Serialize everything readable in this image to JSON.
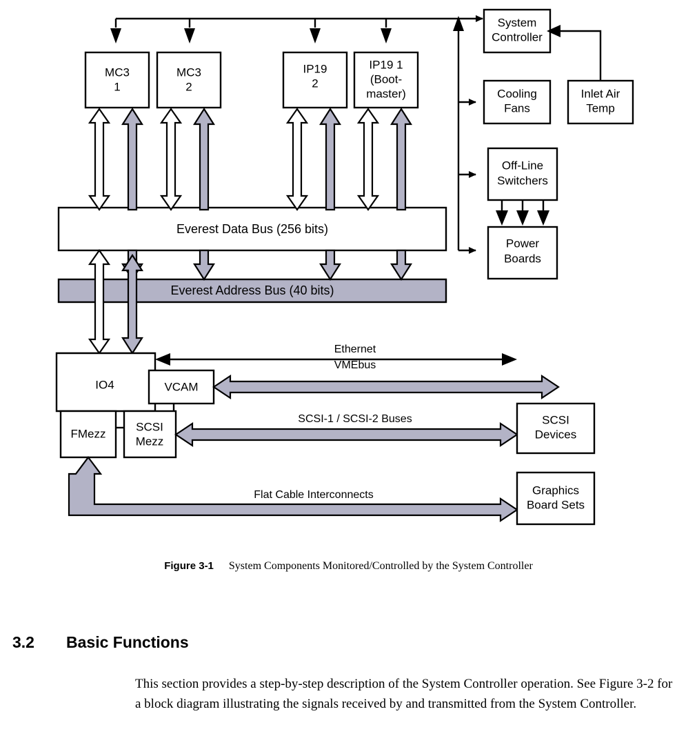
{
  "figure": {
    "number": "Figure 3-1",
    "caption": "System Components Monitored/Controlled by the System Controller"
  },
  "section": {
    "number": "3.2",
    "title": "Basic Functions",
    "body": "This section provides a step-by-step description of the System Controller operation. See Figure 3-2 for a block diagram illustrating the signals received by and transmitted from the System Controller."
  },
  "diagram": {
    "boxes": {
      "mc3_1": {
        "line1": "MC3",
        "line2": "1"
      },
      "mc3_2": {
        "line1": "MC3",
        "line2": "2"
      },
      "ip19_2": {
        "line1": "IP19",
        "line2": "2"
      },
      "ip19_1": {
        "line1": "IP19 1",
        "line2": "(Boot-",
        "line3": "master)"
      },
      "system_controller": {
        "line1": "System",
        "line2": "Controller"
      },
      "cooling_fans": {
        "line1": "Cooling",
        "line2": "Fans"
      },
      "inlet_air_temp": {
        "line1": "Inlet Air",
        "line2": "Temp"
      },
      "offline_switchers": {
        "line1": "Off-Line",
        "line2": "Switchers"
      },
      "power_boards": {
        "line1": "Power",
        "line2": "Boards"
      },
      "io4": {
        "line1": "IO4"
      },
      "vcam": {
        "line1": "VCAM"
      },
      "fmezz": {
        "line1": "FMezz"
      },
      "scsi_mezz": {
        "line1": "SCSI",
        "line2": "Mezz"
      },
      "scsi_devices": {
        "line1": "SCSI",
        "line2": "Devices"
      },
      "graphics_boards": {
        "line1": "Graphics",
        "line2": "Board Sets"
      }
    },
    "buses": {
      "data_bus": "Everest Data Bus (256 bits)",
      "address_bus": "Everest Address Bus (40 bits)"
    },
    "connections": {
      "ethernet": "Ethernet",
      "vmebus": "VMEbus",
      "scsi": "SCSI-1 / SCSI-2 Buses",
      "flat_cable": "Flat Cable Interconnects"
    },
    "colors": {
      "shaded_fill": "#b3b3c6",
      "line": "#000000",
      "box_fill": "#ffffff"
    }
  }
}
